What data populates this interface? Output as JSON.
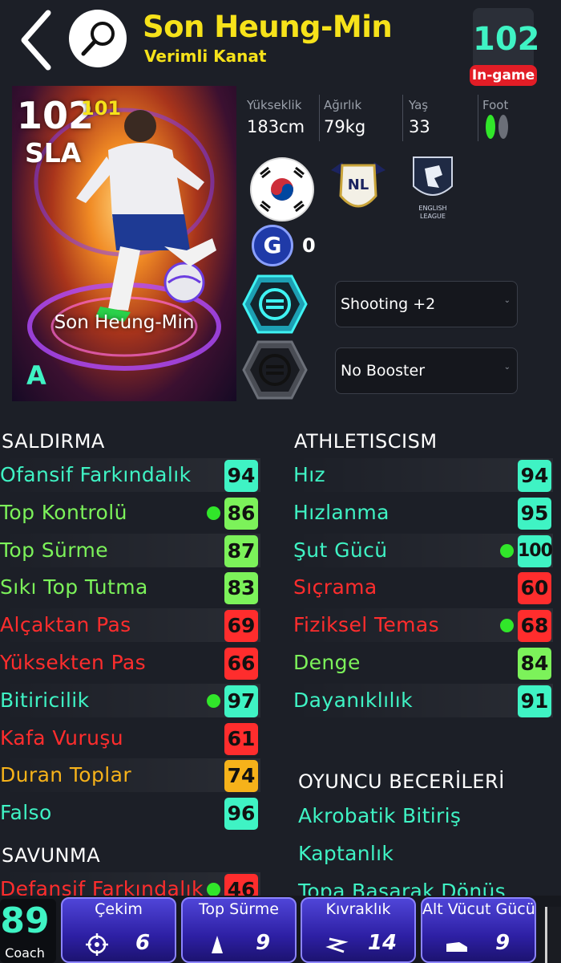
{
  "header": {
    "player_name": "Son Heung-Min",
    "player_role": "Verimli Kanat",
    "ingame_rating": "102",
    "ingame_label": "In-game"
  },
  "card": {
    "overall": "102",
    "overall_alt": "101",
    "position": "SLA",
    "name": "Son Heung-Min",
    "grade": "A"
  },
  "bio": {
    "height_label": "Yükseklik",
    "height": "183cm",
    "weight_label": "Ağırlık",
    "weight": "79kg",
    "age_label": "Yaş",
    "age": "33",
    "foot_label": "Foot",
    "badge_league_text": "ENGLISH LEAGUE"
  },
  "gp": {
    "letter": "G",
    "value": "0"
  },
  "boosters": [
    {
      "label": "Shooting +2",
      "active": true
    },
    {
      "label": "No Booster",
      "active": false
    }
  ],
  "attack": {
    "title": "SALDIRMA",
    "stats": [
      {
        "name": "Ofansif Farkındalık",
        "value": "94",
        "color": "#3ff3c4",
        "tier": "#3ff3c4",
        "dot": false
      },
      {
        "name": "Top Kontrolü",
        "value": "86",
        "color": "#7cf25a",
        "tier": "#7cf25a",
        "dot": true
      },
      {
        "name": "Top Sürme",
        "value": "87",
        "color": "#7cf25a",
        "tier": "#7cf25a",
        "dot": false
      },
      {
        "name": "Sıkı Top Tutma",
        "value": "83",
        "color": "#7cf25a",
        "tier": "#7cf25a",
        "dot": false
      },
      {
        "name": "Alçaktan Pas",
        "value": "69",
        "color": "#ff2d2d",
        "tier": "#ff2d2d",
        "dot": false
      },
      {
        "name": "Yüksekten Pas",
        "value": "66",
        "color": "#ff2d2d",
        "tier": "#ff2d2d",
        "dot": false
      },
      {
        "name": "Bitiricilik",
        "value": "97",
        "color": "#3ff3c4",
        "tier": "#3ff3c4",
        "dot": true
      },
      {
        "name": "Kafa Vuruşu",
        "value": "61",
        "color": "#ff2d2d",
        "tier": "#ff2d2d",
        "dot": false
      },
      {
        "name": "Duran Toplar",
        "value": "74",
        "color": "#f6b21a",
        "tier": "#f6b21a",
        "dot": false
      },
      {
        "name": "Falso",
        "value": "96",
        "color": "#3ff3c4",
        "tier": "#3ff3c4",
        "dot": false
      }
    ]
  },
  "defense": {
    "title": "SAVUNMA",
    "stats": [
      {
        "name": "Defansif Farkındalık",
        "value": "46",
        "color": "#ff2d2d",
        "tier": "#ff2d2d",
        "dot": true
      }
    ]
  },
  "athletics": {
    "title": "ATHLETISCISM",
    "stats": [
      {
        "name": "Hız",
        "value": "94",
        "color": "#3ff3c4",
        "tier": "#3ff3c4",
        "dot": false
      },
      {
        "name": "Hızlanma",
        "value": "95",
        "color": "#3ff3c4",
        "tier": "#3ff3c4",
        "dot": false
      },
      {
        "name": "Şut Gücü",
        "value": "100",
        "color": "#3ff3c4",
        "tier": "#3ff3c4",
        "dot": true
      },
      {
        "name": "Sıçrama",
        "value": "60",
        "color": "#ff2d2d",
        "tier": "#ff2d2d",
        "dot": false
      },
      {
        "name": "Fiziksel Temas",
        "value": "68",
        "color": "#ff2d2d",
        "tier": "#ff2d2d",
        "dot": true
      },
      {
        "name": "Denge",
        "value": "84",
        "color": "#7cf25a",
        "tier": "#7cf25a",
        "dot": false
      },
      {
        "name": "Dayanıklılık",
        "value": "91",
        "color": "#3ff3c4",
        "tier": "#3ff3c4",
        "dot": false
      }
    ]
  },
  "skills": {
    "title": "OYUNCU BECERİLERİ",
    "items": [
      "Akrobatik Bitiriş",
      "Kaptanlık",
      "Topa Basarak Dönüş"
    ]
  },
  "coach": {
    "value": "89",
    "label": "Coach"
  },
  "bottom_tabs": [
    {
      "label": "Çekim",
      "value": "6",
      "icon": "crosshair-icon"
    },
    {
      "label": "Top Sürme",
      "value": "9",
      "icon": "cone-icon"
    },
    {
      "label": "Kıvraklık",
      "value": "14",
      "icon": "zigzag-icon"
    },
    {
      "label": "Alt Vücut Gücü",
      "value": "9",
      "icon": "boot-icon"
    }
  ]
}
